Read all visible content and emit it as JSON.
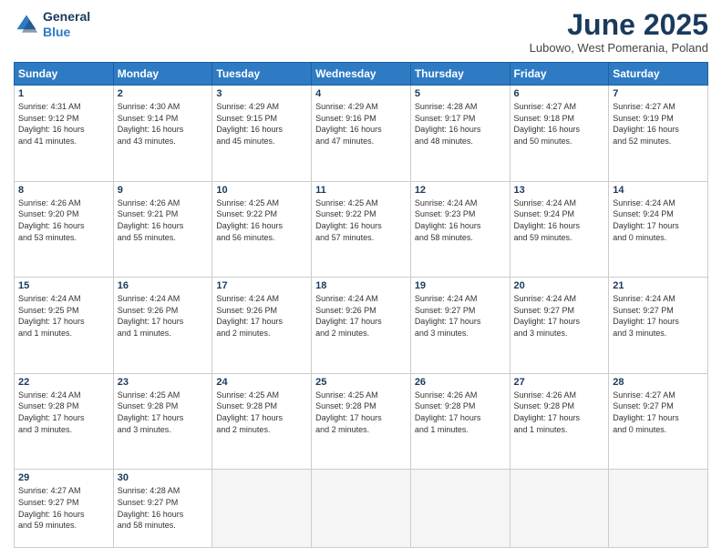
{
  "header": {
    "logo_line1": "General",
    "logo_line2": "Blue",
    "month_title": "June 2025",
    "location": "Lubowo, West Pomerania, Poland"
  },
  "weekdays": [
    "Sunday",
    "Monday",
    "Tuesday",
    "Wednesday",
    "Thursday",
    "Friday",
    "Saturday"
  ],
  "weeks": [
    [
      {
        "day": "1",
        "sunrise": "4:31 AM",
        "sunset": "9:12 PM",
        "daylight": "16 hours and 41 minutes."
      },
      {
        "day": "2",
        "sunrise": "4:30 AM",
        "sunset": "9:14 PM",
        "daylight": "16 hours and 43 minutes."
      },
      {
        "day": "3",
        "sunrise": "4:29 AM",
        "sunset": "9:15 PM",
        "daylight": "16 hours and 45 minutes."
      },
      {
        "day": "4",
        "sunrise": "4:29 AM",
        "sunset": "9:16 PM",
        "daylight": "16 hours and 47 minutes."
      },
      {
        "day": "5",
        "sunrise": "4:28 AM",
        "sunset": "9:17 PM",
        "daylight": "16 hours and 48 minutes."
      },
      {
        "day": "6",
        "sunrise": "4:27 AM",
        "sunset": "9:18 PM",
        "daylight": "16 hours and 50 minutes."
      },
      {
        "day": "7",
        "sunrise": "4:27 AM",
        "sunset": "9:19 PM",
        "daylight": "16 hours and 52 minutes."
      }
    ],
    [
      {
        "day": "8",
        "sunrise": "4:26 AM",
        "sunset": "9:20 PM",
        "daylight": "16 hours and 53 minutes."
      },
      {
        "day": "9",
        "sunrise": "4:26 AM",
        "sunset": "9:21 PM",
        "daylight": "16 hours and 55 minutes."
      },
      {
        "day": "10",
        "sunrise": "4:25 AM",
        "sunset": "9:22 PM",
        "daylight": "16 hours and 56 minutes."
      },
      {
        "day": "11",
        "sunrise": "4:25 AM",
        "sunset": "9:22 PM",
        "daylight": "16 hours and 57 minutes."
      },
      {
        "day": "12",
        "sunrise": "4:24 AM",
        "sunset": "9:23 PM",
        "daylight": "16 hours and 58 minutes."
      },
      {
        "day": "13",
        "sunrise": "4:24 AM",
        "sunset": "9:24 PM",
        "daylight": "16 hours and 59 minutes."
      },
      {
        "day": "14",
        "sunrise": "4:24 AM",
        "sunset": "9:24 PM",
        "daylight": "17 hours and 0 minutes."
      }
    ],
    [
      {
        "day": "15",
        "sunrise": "4:24 AM",
        "sunset": "9:25 PM",
        "daylight": "17 hours and 1 minute."
      },
      {
        "day": "16",
        "sunrise": "4:24 AM",
        "sunset": "9:26 PM",
        "daylight": "17 hours and 1 minute."
      },
      {
        "day": "17",
        "sunrise": "4:24 AM",
        "sunset": "9:26 PM",
        "daylight": "17 hours and 2 minutes."
      },
      {
        "day": "18",
        "sunrise": "4:24 AM",
        "sunset": "9:26 PM",
        "daylight": "17 hours and 2 minutes."
      },
      {
        "day": "19",
        "sunrise": "4:24 AM",
        "sunset": "9:27 PM",
        "daylight": "17 hours and 3 minutes."
      },
      {
        "day": "20",
        "sunrise": "4:24 AM",
        "sunset": "9:27 PM",
        "daylight": "17 hours and 3 minutes."
      },
      {
        "day": "21",
        "sunrise": "4:24 AM",
        "sunset": "9:27 PM",
        "daylight": "17 hours and 3 minutes."
      }
    ],
    [
      {
        "day": "22",
        "sunrise": "4:24 AM",
        "sunset": "9:28 PM",
        "daylight": "17 hours and 3 minutes."
      },
      {
        "day": "23",
        "sunrise": "4:25 AM",
        "sunset": "9:28 PM",
        "daylight": "17 hours and 3 minutes."
      },
      {
        "day": "24",
        "sunrise": "4:25 AM",
        "sunset": "9:28 PM",
        "daylight": "17 hours and 2 minutes."
      },
      {
        "day": "25",
        "sunrise": "4:25 AM",
        "sunset": "9:28 PM",
        "daylight": "17 hours and 2 minutes."
      },
      {
        "day": "26",
        "sunrise": "4:26 AM",
        "sunset": "9:28 PM",
        "daylight": "17 hours and 1 minute."
      },
      {
        "day": "27",
        "sunrise": "4:26 AM",
        "sunset": "9:28 PM",
        "daylight": "17 hours and 1 minute."
      },
      {
        "day": "28",
        "sunrise": "4:27 AM",
        "sunset": "9:27 PM",
        "daylight": "17 hours and 0 minutes."
      }
    ],
    [
      {
        "day": "29",
        "sunrise": "4:27 AM",
        "sunset": "9:27 PM",
        "daylight": "16 hours and 59 minutes."
      },
      {
        "day": "30",
        "sunrise": "4:28 AM",
        "sunset": "9:27 PM",
        "daylight": "16 hours and 58 minutes."
      },
      null,
      null,
      null,
      null,
      null
    ]
  ]
}
